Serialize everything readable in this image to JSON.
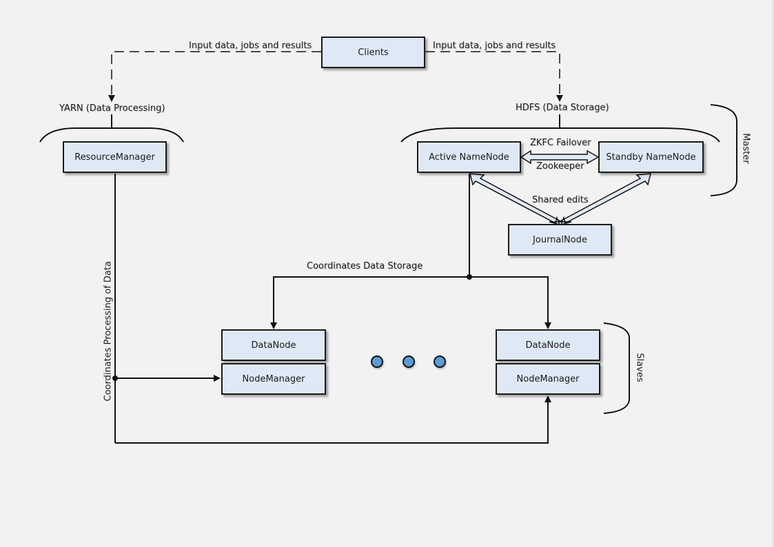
{
  "diagram": {
    "nodes": {
      "clients": "Clients",
      "resource_manager": "ResourceManager",
      "active_namenode": "Active NameNode",
      "standby_namenode": "Standby NameNode",
      "journalnode": "JournalNode",
      "datanode_left": "DataNode",
      "nodemanager_left": "NodeManager",
      "datanode_right": "DataNode",
      "nodemanager_right": "NodeManager"
    },
    "labels": {
      "input_left": "Input data, jobs and results",
      "input_right": "Input data, jobs and results",
      "yarn": "YARN (Data Processing)",
      "hdfs": "HDFS (Data Storage)",
      "zkfc": "ZKFC Failover",
      "zookeeper": "Zookeeper",
      "shared_edits": "Shared edits",
      "coordinates_storage": "Coordinates Data Storage",
      "coordinates_processing": "Coordinates Processing of Data",
      "master": "Master",
      "slaves": "Slaves"
    },
    "colors": {
      "node_fill": "#dfe9f5",
      "ellipsis_dot": "#5b9bd5",
      "background": "#f2f2f2"
    }
  }
}
